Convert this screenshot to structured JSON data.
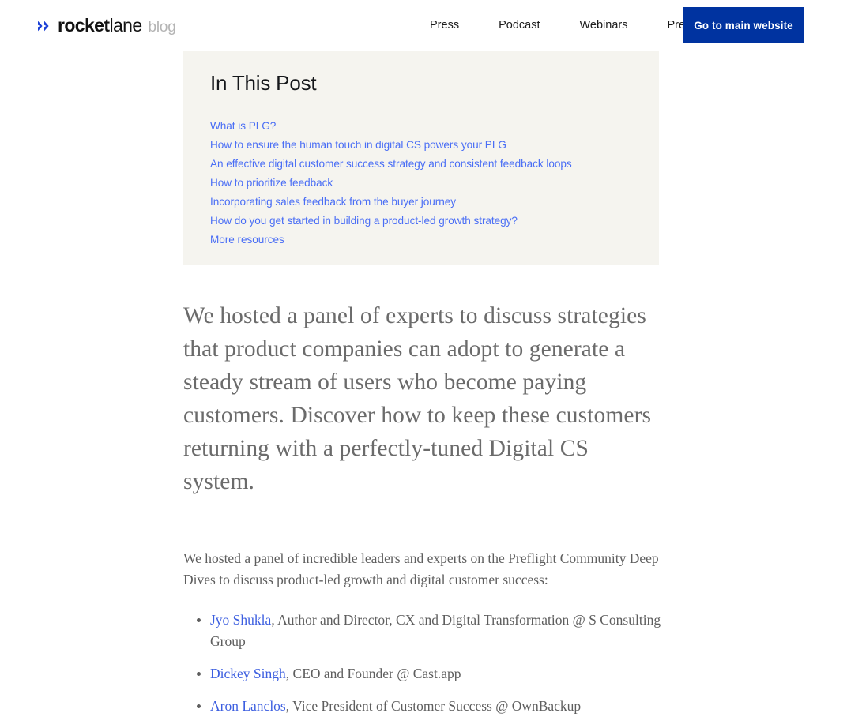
{
  "header": {
    "brand": {
      "icon": "double-chevron-icon",
      "name_bold": "rocket",
      "name_light": "lane",
      "sub": "blog"
    },
    "nav": [
      {
        "label": "Press"
      },
      {
        "label": "Podcast"
      },
      {
        "label": "Webinars"
      },
      {
        "label": "Preflight"
      }
    ],
    "cta": {
      "label": "Go to main website",
      "bg": "#0033a0",
      "color": "#ffffff"
    }
  },
  "toc": {
    "title": "In This Post",
    "bg": "#f5f4ef",
    "link_color": "#4a6ef5",
    "items": [
      {
        "label": "What is PLG?"
      },
      {
        "label": "How to ensure the human touch in digital CS powers your PLG"
      },
      {
        "label": "An effective digital customer success strategy and consistent feedback loops"
      },
      {
        "label": "How to prioritize feedback"
      },
      {
        "label": "Incorporating sales feedback from the buyer journey"
      },
      {
        "label": "How do you get started in building a product-led growth strategy?"
      },
      {
        "label": "More resources"
      }
    ]
  },
  "article": {
    "lede": "We hosted a panel of experts to discuss strategies that product companies can adopt to generate a steady stream of users who become paying customers. Discover how to keep these customers returning with a perfectly-tuned Digital CS system.",
    "paragraph": "We hosted a panel of incredible leaders and experts on the Preflight Community Deep Dives to discuss product-led growth and digital customer success:",
    "people": [
      {
        "name": "Jyo Shukla",
        "role": ", Author and Director, CX and Digital Transformation @ S Consulting Group"
      },
      {
        "name": "Dickey Singh",
        "role": ", CEO and Founder @ Cast.app"
      },
      {
        "name": "Aron Lanclos",
        "role": ", Vice President of Customer Success @ OwnBackup"
      }
    ],
    "link_color": "#3d5fe0"
  }
}
